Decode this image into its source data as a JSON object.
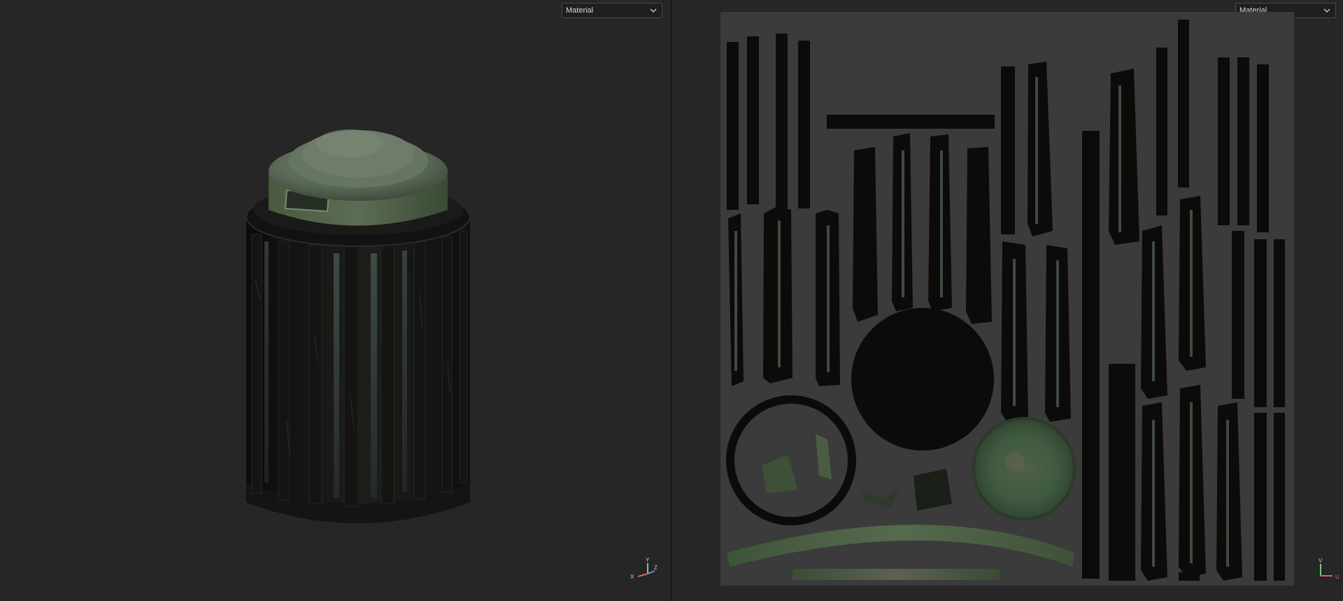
{
  "viewport_3d": {
    "shading_mode": "Material",
    "axes": {
      "y": "Y",
      "x": "X",
      "z": "Z"
    }
  },
  "viewport_uv": {
    "shading_mode": "Material",
    "axes": {
      "v": "V",
      "u": "U"
    }
  },
  "icons": {
    "dropdown": "chevron-down-icon",
    "model": "cylindrical-canister-model",
    "uv_layout": "uv-texture-layout"
  },
  "colors": {
    "background": "#262626",
    "dropdown_bg": "#1f1f1f",
    "uv_tile": "#3b3b3b",
    "axis_x": "#e06060",
    "axis_y": "#70d070",
    "axis_z": "#7090e0",
    "paint_green": "#4b5e44"
  }
}
